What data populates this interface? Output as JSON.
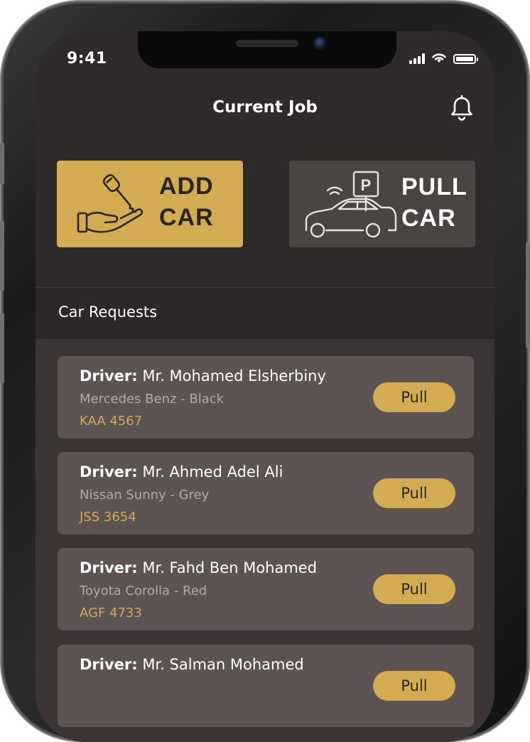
{
  "status_bar": {
    "time": "9:41"
  },
  "header": {
    "title": "Current Job"
  },
  "actions": {
    "add": {
      "line1": "ADD",
      "line2": "CAR"
    },
    "pull": {
      "line1": "PULL",
      "line2": "CAR",
      "sign": "P"
    }
  },
  "requests": {
    "section_title": "Car Requests",
    "driver_prefix": "Driver:",
    "items": [
      {
        "driver": "Mr. Mohamed Elsherbiny",
        "car": "Mercedes Benz - Black",
        "plate": "KAA 4567",
        "action": "Pull"
      },
      {
        "driver": "Mr. Ahmed Adel Ali",
        "car": "Nissan Sunny - Grey",
        "plate": "JSS 3654",
        "action": "Pull"
      },
      {
        "driver": "Mr. Fahd Ben Mohamed",
        "car": "Toyota Corolla - Red",
        "plate": "AGF 4733",
        "action": "Pull"
      },
      {
        "driver": "Mr. Salman Mohamed",
        "car": "",
        "plate": "",
        "action": "Pull"
      }
    ]
  },
  "colors": {
    "accent": "#d3ac51",
    "background": "#2e2a29",
    "card": "#5d5352",
    "pull_button_bg": "#4a4443"
  },
  "icons": {
    "notification": "bell-icon",
    "add_car": "hand-key-icon",
    "pull_car": "car-parking-wifi-icon"
  }
}
